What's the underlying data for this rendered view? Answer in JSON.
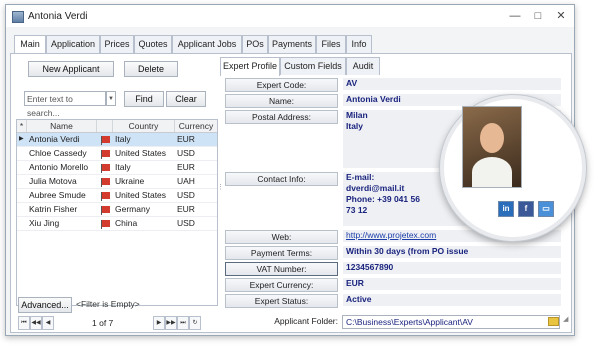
{
  "window": {
    "title": "Antonia Verdi",
    "controls": [
      "—",
      "□",
      "✕"
    ]
  },
  "main_tabs": [
    {
      "label": "Main",
      "active": true
    },
    {
      "label": "Application"
    },
    {
      "label": "Prices"
    },
    {
      "label": "Quotes"
    },
    {
      "label": "Applicant Jobs"
    },
    {
      "label": "POs"
    },
    {
      "label": "Payments"
    },
    {
      "label": "Files"
    },
    {
      "label": "Info"
    }
  ],
  "left_panel": {
    "new_button": "New Applicant",
    "delete_button": "Delete",
    "search_placeholder": "Enter text to search...",
    "find_button": "Find",
    "clear_button": "Clear",
    "columns": [
      "Name",
      "Country",
      "Currency"
    ],
    "rows": [
      {
        "name": "Antonia Verdi",
        "country": "Italy",
        "currency": "EUR",
        "selected": true
      },
      {
        "name": "Chloe Cassedy",
        "country": "United States",
        "currency": "USD"
      },
      {
        "name": "Antonio Morello",
        "country": "Italy",
        "currency": "EUR"
      },
      {
        "name": "Julia Motova",
        "country": "Ukraine",
        "currency": "UAH"
      },
      {
        "name": "Aubree Smude",
        "country": "United States",
        "currency": "USD"
      },
      {
        "name": "Katrin Fisher",
        "country": "Germany",
        "currency": "EUR"
      },
      {
        "name": "Xiu Jing",
        "country": "China",
        "currency": "USD"
      }
    ],
    "advanced_button": "Advanced...",
    "filter_text": "<Filter is Empty>",
    "pager_text": "1 of 7"
  },
  "right_tabs": [
    {
      "label": "Expert Profile",
      "active": true
    },
    {
      "label": "Custom Fields"
    },
    {
      "label": "Audit"
    }
  ],
  "profile": {
    "expert_code_label": "Expert Code:",
    "expert_code": "AV",
    "name_label": "Name:",
    "name": "Antonia Verdi",
    "postal_label": "Postal Address:",
    "postal_line1": "Milan",
    "postal_line2": "Italy",
    "contact_label": "Contact Info:",
    "contact_line1": "E-mail:",
    "contact_line2": "dverdi@mail.it",
    "contact_line3": "Phone: +39 041 56",
    "contact_line4": "73 12",
    "web_label": "Web:",
    "web": "http://www.projetex.com",
    "payment_label": "Payment Terms:",
    "payment": "Within 30 days (from PO issue",
    "vat_label": "VAT Number:",
    "vat": "1234567890",
    "currency_label": "Expert Currency:",
    "currency": "EUR",
    "status_label": "Expert Status:",
    "status": "Active",
    "folder_label": "Applicant Folder:",
    "folder": "C:\\Business\\Experts\\Applicant\\AV"
  },
  "social": [
    {
      "icon": "linkedin-icon",
      "text": "in",
      "color": "#2a6ebb"
    },
    {
      "icon": "facebook-icon",
      "text": "f",
      "color": "#3b5998"
    },
    {
      "icon": "profile-icon",
      "text": "▭",
      "color": "#4a90d9"
    }
  ]
}
